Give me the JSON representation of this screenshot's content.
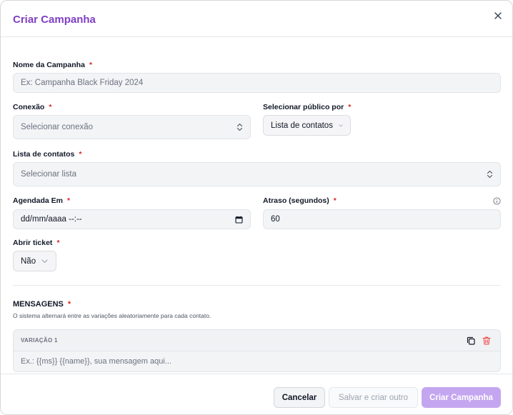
{
  "modal": {
    "title": "Criar Campanha"
  },
  "form": {
    "campaign_name": {
      "label": "Nome da Campanha",
      "placeholder": "Ex: Campanha Black Friday 2024"
    },
    "connection": {
      "label": "Conexão",
      "value": "Selecionar conexão"
    },
    "audience_by": {
      "label": "Selecionar público por",
      "value": "Lista de contatos"
    },
    "contact_list": {
      "label": "Lista de contatos",
      "value": "Selecionar lista"
    },
    "scheduled_at": {
      "label": "Agendada Em",
      "value": "dd/mm/aaaa --:--"
    },
    "delay": {
      "label": "Atraso (segundos)",
      "value": "60"
    },
    "open_ticket": {
      "label": "Abrir ticket",
      "value": "Não"
    },
    "required_mark": "*"
  },
  "messages": {
    "label": "MENSAGENS",
    "help": "O sistema alternará entre as variações aleatoriamente para cada contato.",
    "variations": [
      {
        "title": "VARIAÇÃO 1",
        "placeholder": "Ex.: {{ms}} {{name}}, sua mensagem aqui..."
      }
    ]
  },
  "footer": {
    "cancel": "Cancelar",
    "save_and_create": "Salvar e criar outro",
    "create": "Criar Campanha"
  },
  "colors": {
    "accent": "#7e3fc4",
    "primary_button": "#c4a6f0",
    "required": "#dc2626",
    "trash": "#ef4444"
  }
}
